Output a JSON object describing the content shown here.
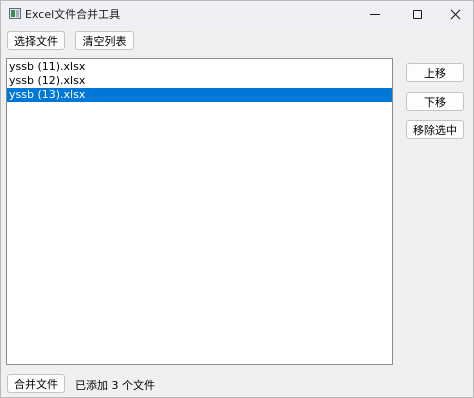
{
  "window": {
    "title": "Excel文件合并工具"
  },
  "toolbar": {
    "select_files_label": "选择文件",
    "clear_list_label": "清空列表"
  },
  "file_list": {
    "items": [
      {
        "name": "yssb (11).xlsx",
        "selected": false
      },
      {
        "name": "yssb (12).xlsx",
        "selected": false
      },
      {
        "name": "yssb (13).xlsx",
        "selected": true
      }
    ]
  },
  "side_buttons": {
    "move_up_label": "上移",
    "move_down_label": "下移",
    "remove_selected_label": "移除选中"
  },
  "footer": {
    "merge_label": "合并文件",
    "status_text": "已添加 3 个文件"
  },
  "colors": {
    "selection": "#0078d7",
    "selection_text": "#ffffff"
  },
  "icons": {
    "app": "spreadsheet-app-icon",
    "minimize": "minimize-icon",
    "maximize": "maximize-icon",
    "close": "close-icon"
  }
}
